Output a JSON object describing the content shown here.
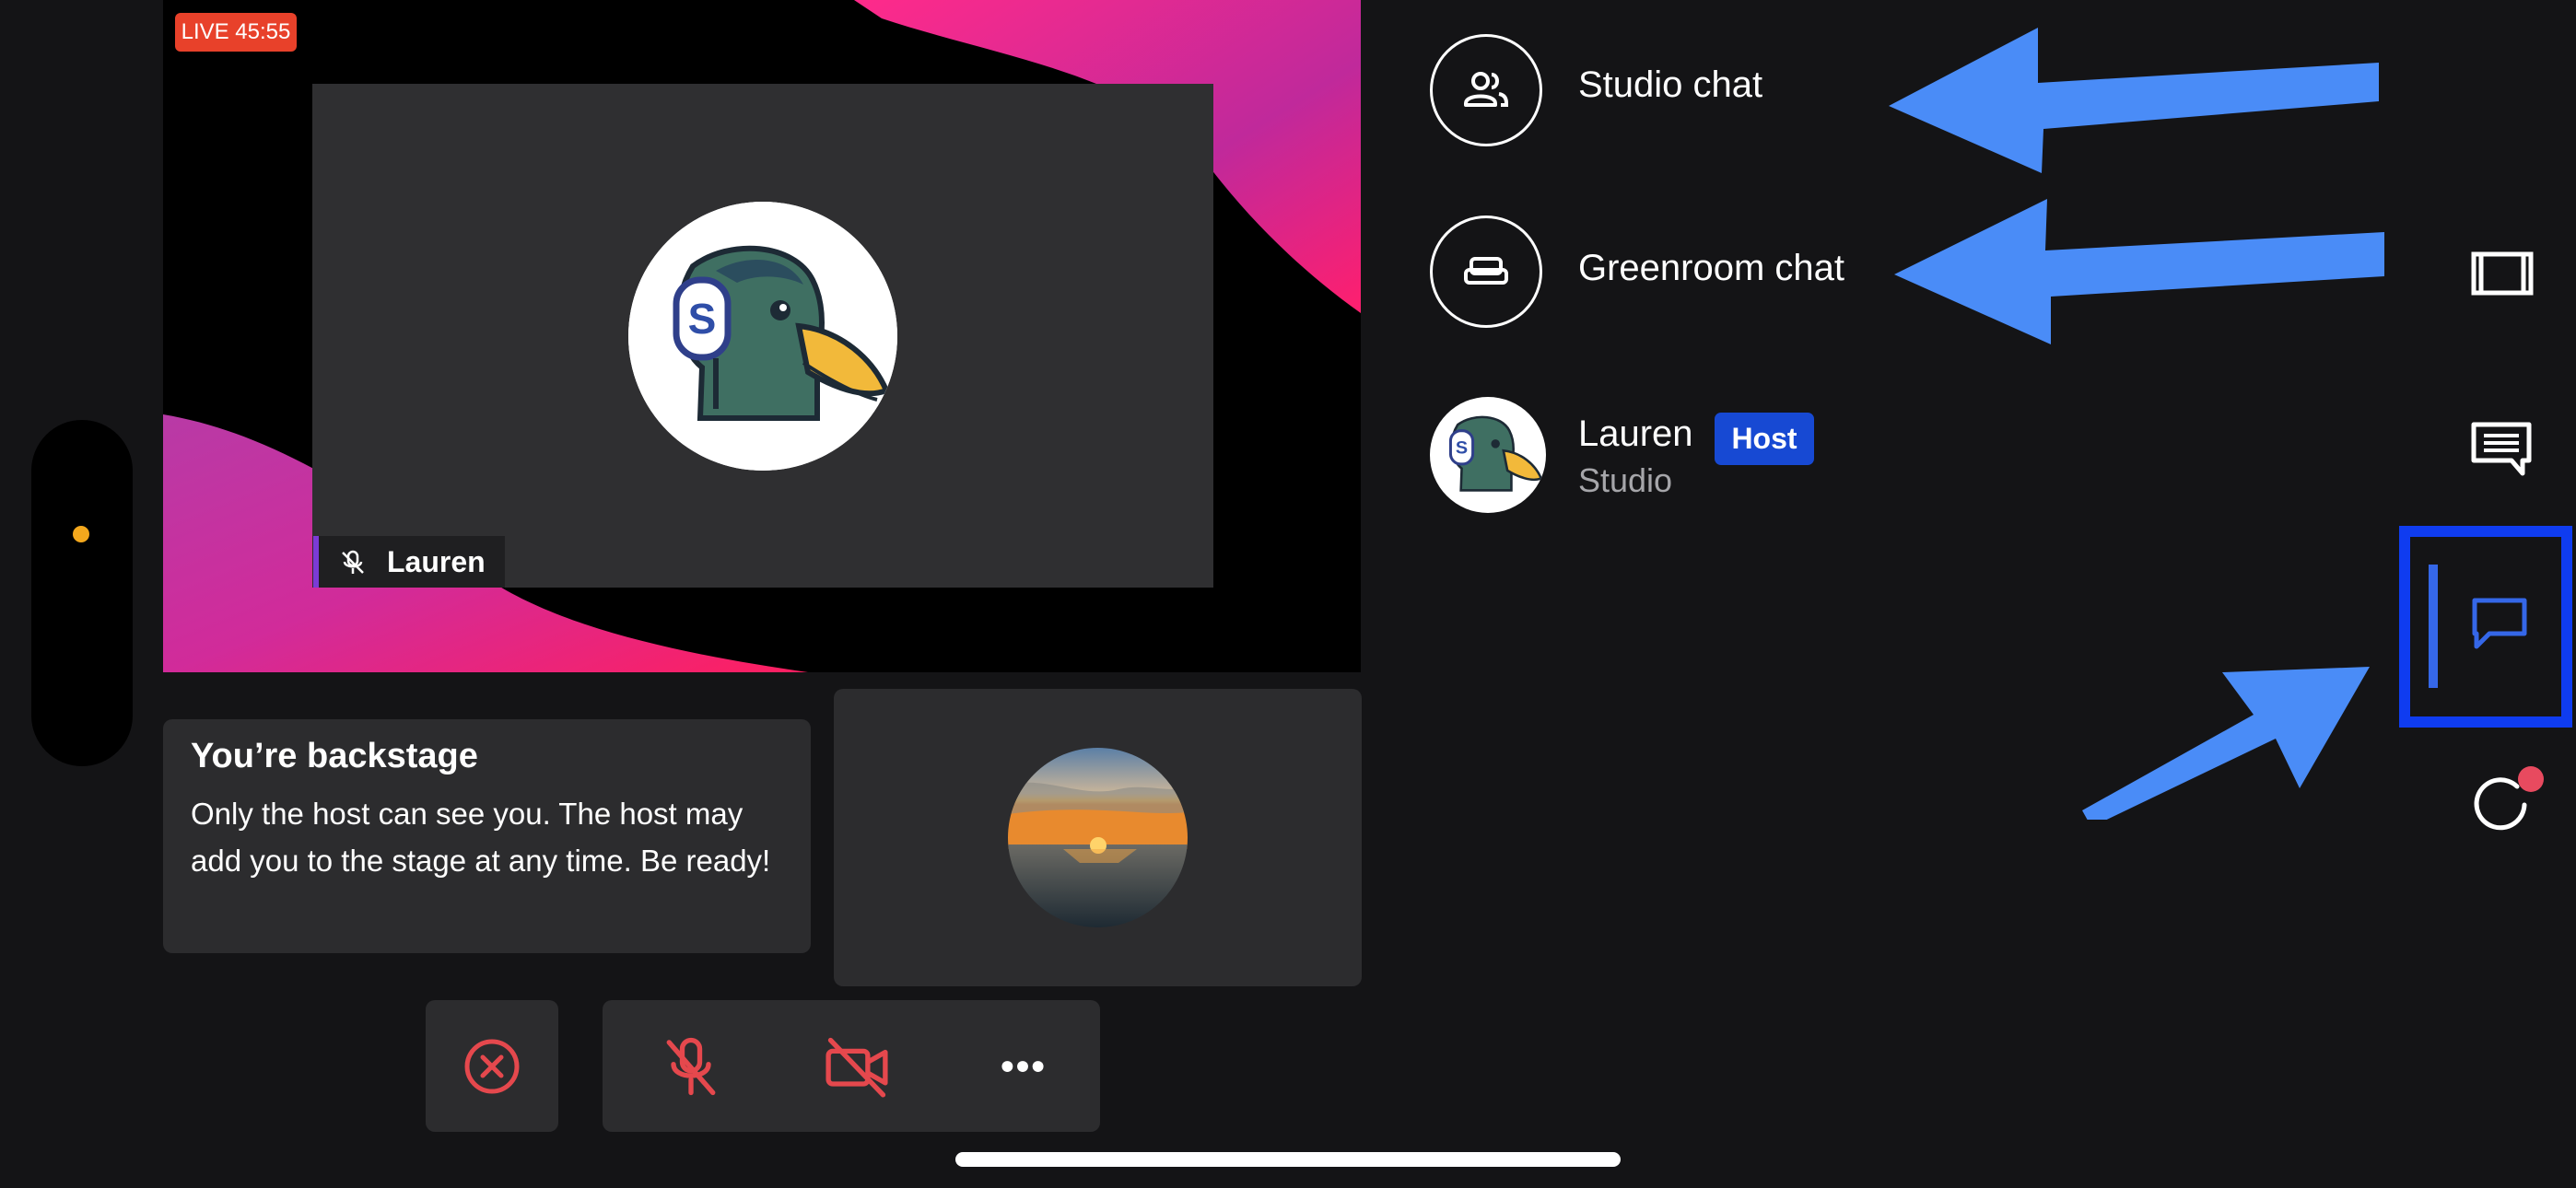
{
  "stage": {
    "live_badge": "LIVE 45:55",
    "participant_name": "Lauren"
  },
  "backstage": {
    "title": "You’re backstage",
    "message": "Only the host can see you. The host may add you to the stage at any time. Be ready!"
  },
  "controls": {
    "leave_icon": "close-circle-icon",
    "mic_icon": "mic-off-icon",
    "camera_icon": "camera-off-icon",
    "more_icon": "more-icon"
  },
  "chat_panel": {
    "studio_chat_label": "Studio chat",
    "greenroom_chat_label": "Greenroom chat",
    "member": {
      "name": "Lauren",
      "badge": "Host",
      "subtitle": "Studio"
    }
  },
  "rail": {
    "items": [
      "layout-icon",
      "comments-icon",
      "chat-icon",
      "record-icon"
    ],
    "selected": "chat-icon"
  },
  "colors": {
    "live_red": "#e8412a",
    "accent_blue": "#3567e8",
    "host_badge": "#1749d3",
    "control_red": "#e5484d",
    "annotation_arrow": "#4a8cf7",
    "highlight_box": "#0f3cf0"
  }
}
